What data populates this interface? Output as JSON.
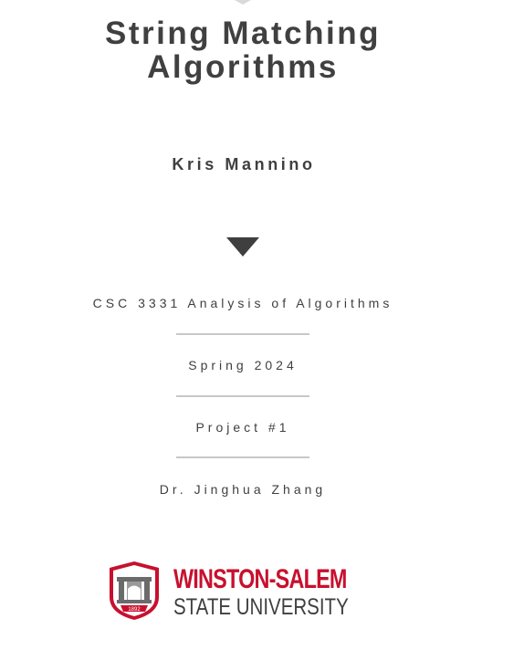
{
  "title": {
    "line1": "String Matching",
    "line2": "Algorithms"
  },
  "author": "Kris Mannino",
  "course": "CSC 3331 Analysis of Algorithms",
  "term": "Spring 2024",
  "project": "Project #1",
  "instructor": "Dr. Jinghua Zhang",
  "logo": {
    "line1": "WINSTON-SALEM",
    "line2": "STATE UNIVERSITY",
    "seal_year": "1892",
    "brand_color": "#c8102e"
  },
  "colors": {
    "text": "#3f3f3f",
    "rule": "#c8c8c8",
    "background": "#ffffff"
  }
}
